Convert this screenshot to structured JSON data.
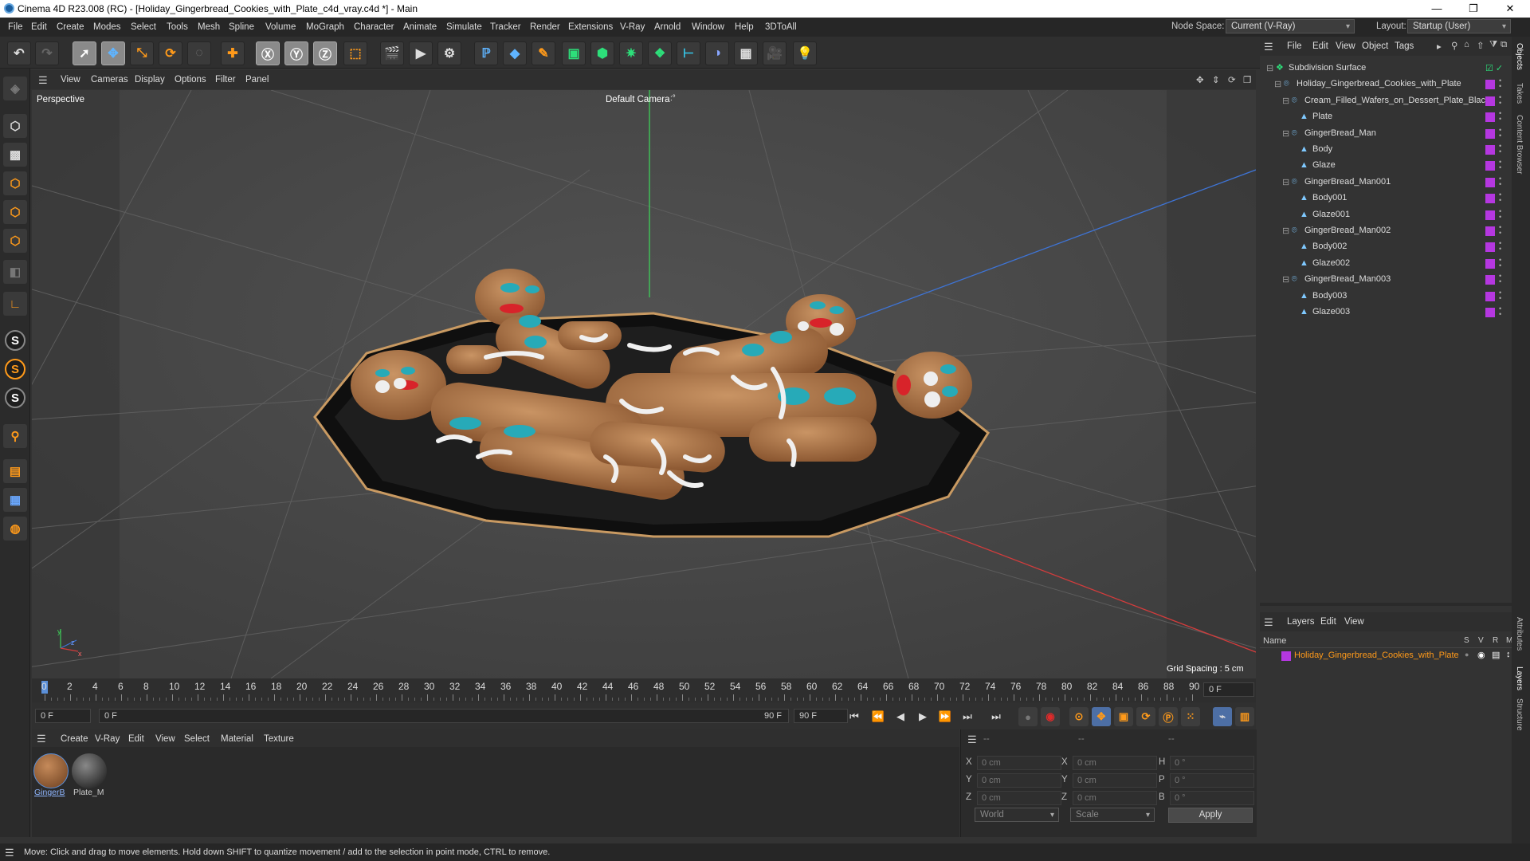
{
  "window": {
    "title": "Cinema 4D R23.008 (RC) - [Holiday_Gingerbread_Cookies_with_Plate_c4d_vray.c4d *] - Main",
    "minimize": "—",
    "maximize": "❐",
    "close": "✕"
  },
  "menubar": {
    "items": [
      "File",
      "Edit",
      "Create",
      "Modes",
      "Select",
      "Tools",
      "Mesh",
      "Spline",
      "Volume",
      "MoGraph",
      "Character",
      "Animate",
      "Simulate",
      "Tracker",
      "Render",
      "Extensions",
      "V-Ray",
      "Arnold",
      "Window",
      "Help",
      "3DToAll"
    ],
    "node_space_label": "Node Space:",
    "node_space_value": "Current (V-Ray)",
    "layout_label": "Layout:",
    "layout_value": "Startup (User)"
  },
  "viewport": {
    "menu": [
      "View",
      "Cameras",
      "Display",
      "Options",
      "Filter",
      "Panel"
    ],
    "view_name": "Perspective",
    "camera": "Default Camera",
    "camera_suffix": ":°",
    "grid_spacing": "Grid Spacing : 5 cm",
    "axis_y": "y",
    "axis_z": "z",
    "axis_x": "x"
  },
  "timeline": {
    "ticks": [
      "0",
      "2",
      "4",
      "6",
      "8",
      "10",
      "12",
      "14",
      "16",
      "18",
      "20",
      "22",
      "24",
      "26",
      "28",
      "30",
      "32",
      "34",
      "36",
      "38",
      "40",
      "42",
      "44",
      "46",
      "48",
      "50",
      "52",
      "54",
      "56",
      "58",
      "60",
      "62",
      "64",
      "66",
      "68",
      "70",
      "72",
      "74",
      "76",
      "78",
      "80",
      "82",
      "84",
      "86",
      "88",
      "90"
    ],
    "current_frame": "0 F"
  },
  "transport": {
    "start_field": "0 F",
    "range_start": "0 F",
    "range_end": "90 F",
    "end_field": "90 F"
  },
  "materials": {
    "menu": [
      "Create",
      "V-Ray",
      "Edit",
      "View",
      "Select",
      "Material",
      "Texture"
    ],
    "items": [
      {
        "label": "GingerB"
      },
      {
        "label": "Plate_M"
      }
    ]
  },
  "coords": {
    "header_dash": "--",
    "header_dash2": "--",
    "header_dash3": "--",
    "rows": [
      {
        "a": "X",
        "a_val": "0 cm",
        "b": "X",
        "b_val": "0 cm",
        "c": "H",
        "c_val": "0 °"
      },
      {
        "a": "Y",
        "a_val": "0 cm",
        "b": "Y",
        "b_val": "0 cm",
        "c": "P",
        "c_val": "0 °"
      },
      {
        "a": "Z",
        "a_val": "0 cm",
        "b": "Z",
        "b_val": "0 cm",
        "c": "B",
        "c_val": "0 °"
      }
    ],
    "world": "World",
    "scale": "Scale",
    "apply": "Apply"
  },
  "objects": {
    "menu": [
      "File",
      "Edit",
      "View",
      "Object",
      "Tags"
    ],
    "tree": [
      {
        "name": "Subdivision Surface",
        "depth": 0
      },
      {
        "name": "Holiday_Gingerbread_Cookies_with_Plate",
        "depth": 1
      },
      {
        "name": "Cream_Filled_Wafers_on_Dessert_Plate_Black",
        "depth": 2
      },
      {
        "name": "Plate",
        "depth": 3
      },
      {
        "name": "GingerBread_Man",
        "depth": 2
      },
      {
        "name": "Body",
        "depth": 3
      },
      {
        "name": "Glaze",
        "depth": 3
      },
      {
        "name": "GingerBread_Man001",
        "depth": 2
      },
      {
        "name": "Body001",
        "depth": 3
      },
      {
        "name": "Glaze001",
        "depth": 3
      },
      {
        "name": "GingerBread_Man002",
        "depth": 2
      },
      {
        "name": "Body002",
        "depth": 3
      },
      {
        "name": "Glaze002",
        "depth": 3
      },
      {
        "name": "GingerBread_Man003",
        "depth": 2
      },
      {
        "name": "Body003",
        "depth": 3
      },
      {
        "name": "Glaze003",
        "depth": 3
      }
    ]
  },
  "layers": {
    "menu": [
      "Layers",
      "Edit",
      "View"
    ],
    "col_name": "Name",
    "cols": [
      "S",
      "V",
      "R",
      "M"
    ],
    "row_name": "Holiday_Gingerbread_Cookies_with_Plate",
    "row_color": "#b537e0"
  },
  "side_tabs": [
    "Objects",
    "Takes",
    "Content Browser",
    "Attributes",
    "Layers",
    "Structure"
  ],
  "status": "Move: Click and drag to move elements. Hold down SHIFT to quantize movement / add to the selection in point mode, CTRL to remove."
}
